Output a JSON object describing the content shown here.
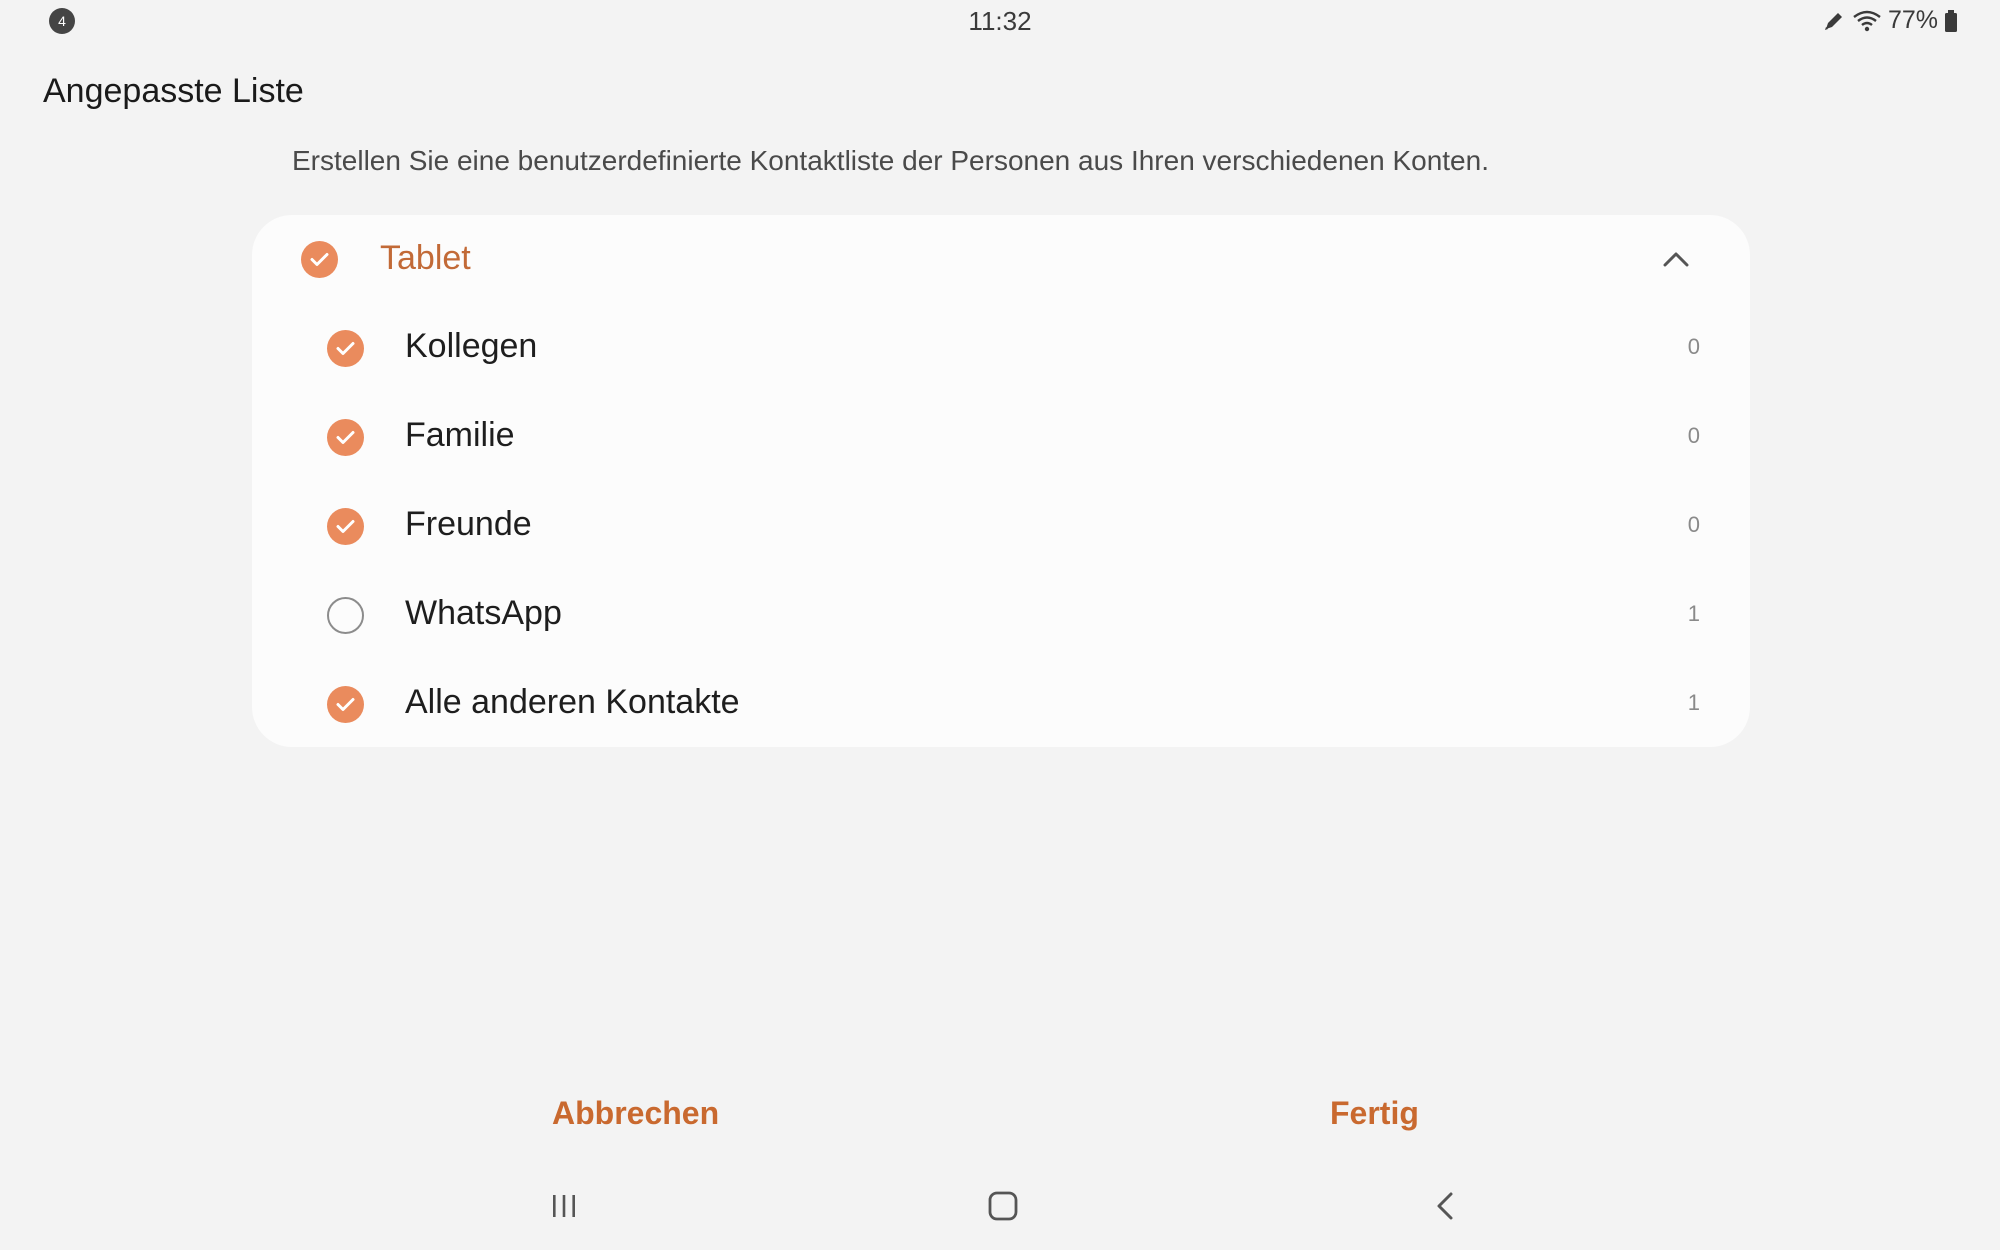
{
  "status_bar": {
    "notification_count": "4",
    "time": "11:32",
    "battery": "77%"
  },
  "header": {
    "title": "Angepasste Liste",
    "description": "Erstellen Sie eine benutzerdefinierte Kontaktliste der Personen aus Ihren verschiedenen Konten."
  },
  "account_group": {
    "label": "Tablet",
    "checked": true,
    "expanded": true,
    "items": [
      {
        "label": "Kollegen",
        "count": "0",
        "checked": true
      },
      {
        "label": "Familie",
        "count": "0",
        "checked": true
      },
      {
        "label": "Freunde",
        "count": "0",
        "checked": true
      },
      {
        "label": "WhatsApp",
        "count": "1",
        "checked": false
      },
      {
        "label": "Alle anderen Kontakte",
        "count": "1",
        "checked": true
      }
    ]
  },
  "actions": {
    "cancel_label": "Abbrechen",
    "done_label": "Fertig"
  },
  "colors": {
    "accent": "#ea8b5d",
    "accent_text": "#c26a37",
    "background": "#f3f3f3",
    "card": "#fcfcfc"
  },
  "icons": {
    "status": [
      "notification-badge",
      "pen-icon",
      "wifi-icon",
      "battery-icon"
    ],
    "navigation": [
      "recent-apps-icon",
      "home-icon",
      "back-icon"
    ]
  }
}
